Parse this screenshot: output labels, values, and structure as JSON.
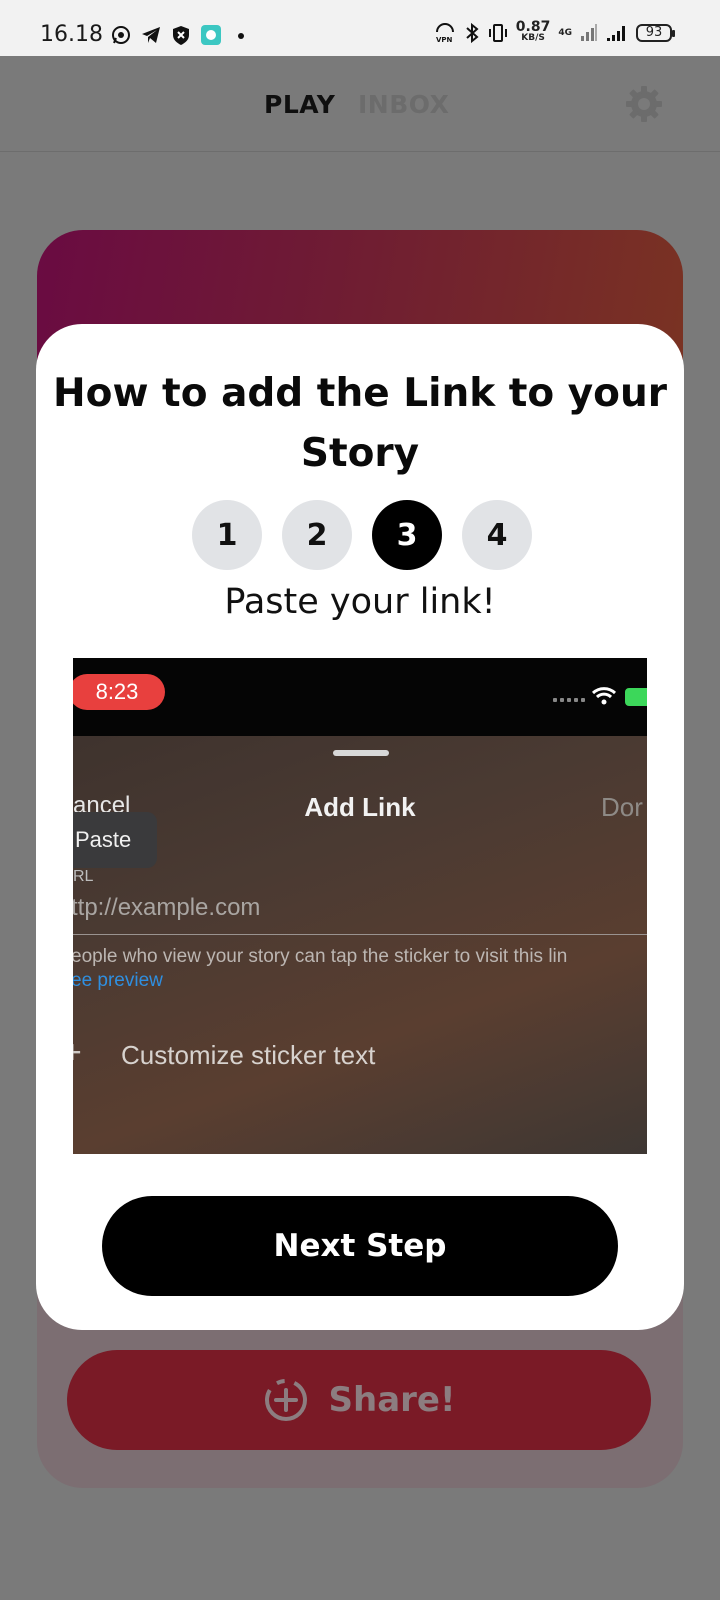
{
  "status_bar": {
    "time": "16.18",
    "speed_value": "0.87",
    "speed_unit": "KB/S",
    "network": "4G",
    "battery": "93"
  },
  "header": {
    "tabs": [
      {
        "label": "PLAY",
        "active": true
      },
      {
        "label": "INBOX",
        "active": false
      }
    ]
  },
  "background": {
    "share_label": "Share!"
  },
  "modal": {
    "title": "How to add the Link to your Story",
    "steps": [
      "1",
      "2",
      "3",
      "4"
    ],
    "active_step": 3,
    "caption": "Paste your link!",
    "preview": {
      "time": "8:23",
      "cancel": "ancel",
      "title": "Add Link",
      "done": "Dor",
      "paste": "Paste",
      "url_label": "RL",
      "url_placeholder": "ttp://example.com",
      "note": "eople who view your story can tap the sticker to visit this lin",
      "see_preview": "ee preview",
      "customize": "Customize sticker text"
    },
    "next_button": "Next Step"
  },
  "colors": {
    "accent_dark": "#000000",
    "active_step": "#000000",
    "inactive_step": "#e1e3e6",
    "share_button": "#7a1a26",
    "paste_time_pill": "#e8403e",
    "see_preview_link": "#2f8fe0"
  }
}
